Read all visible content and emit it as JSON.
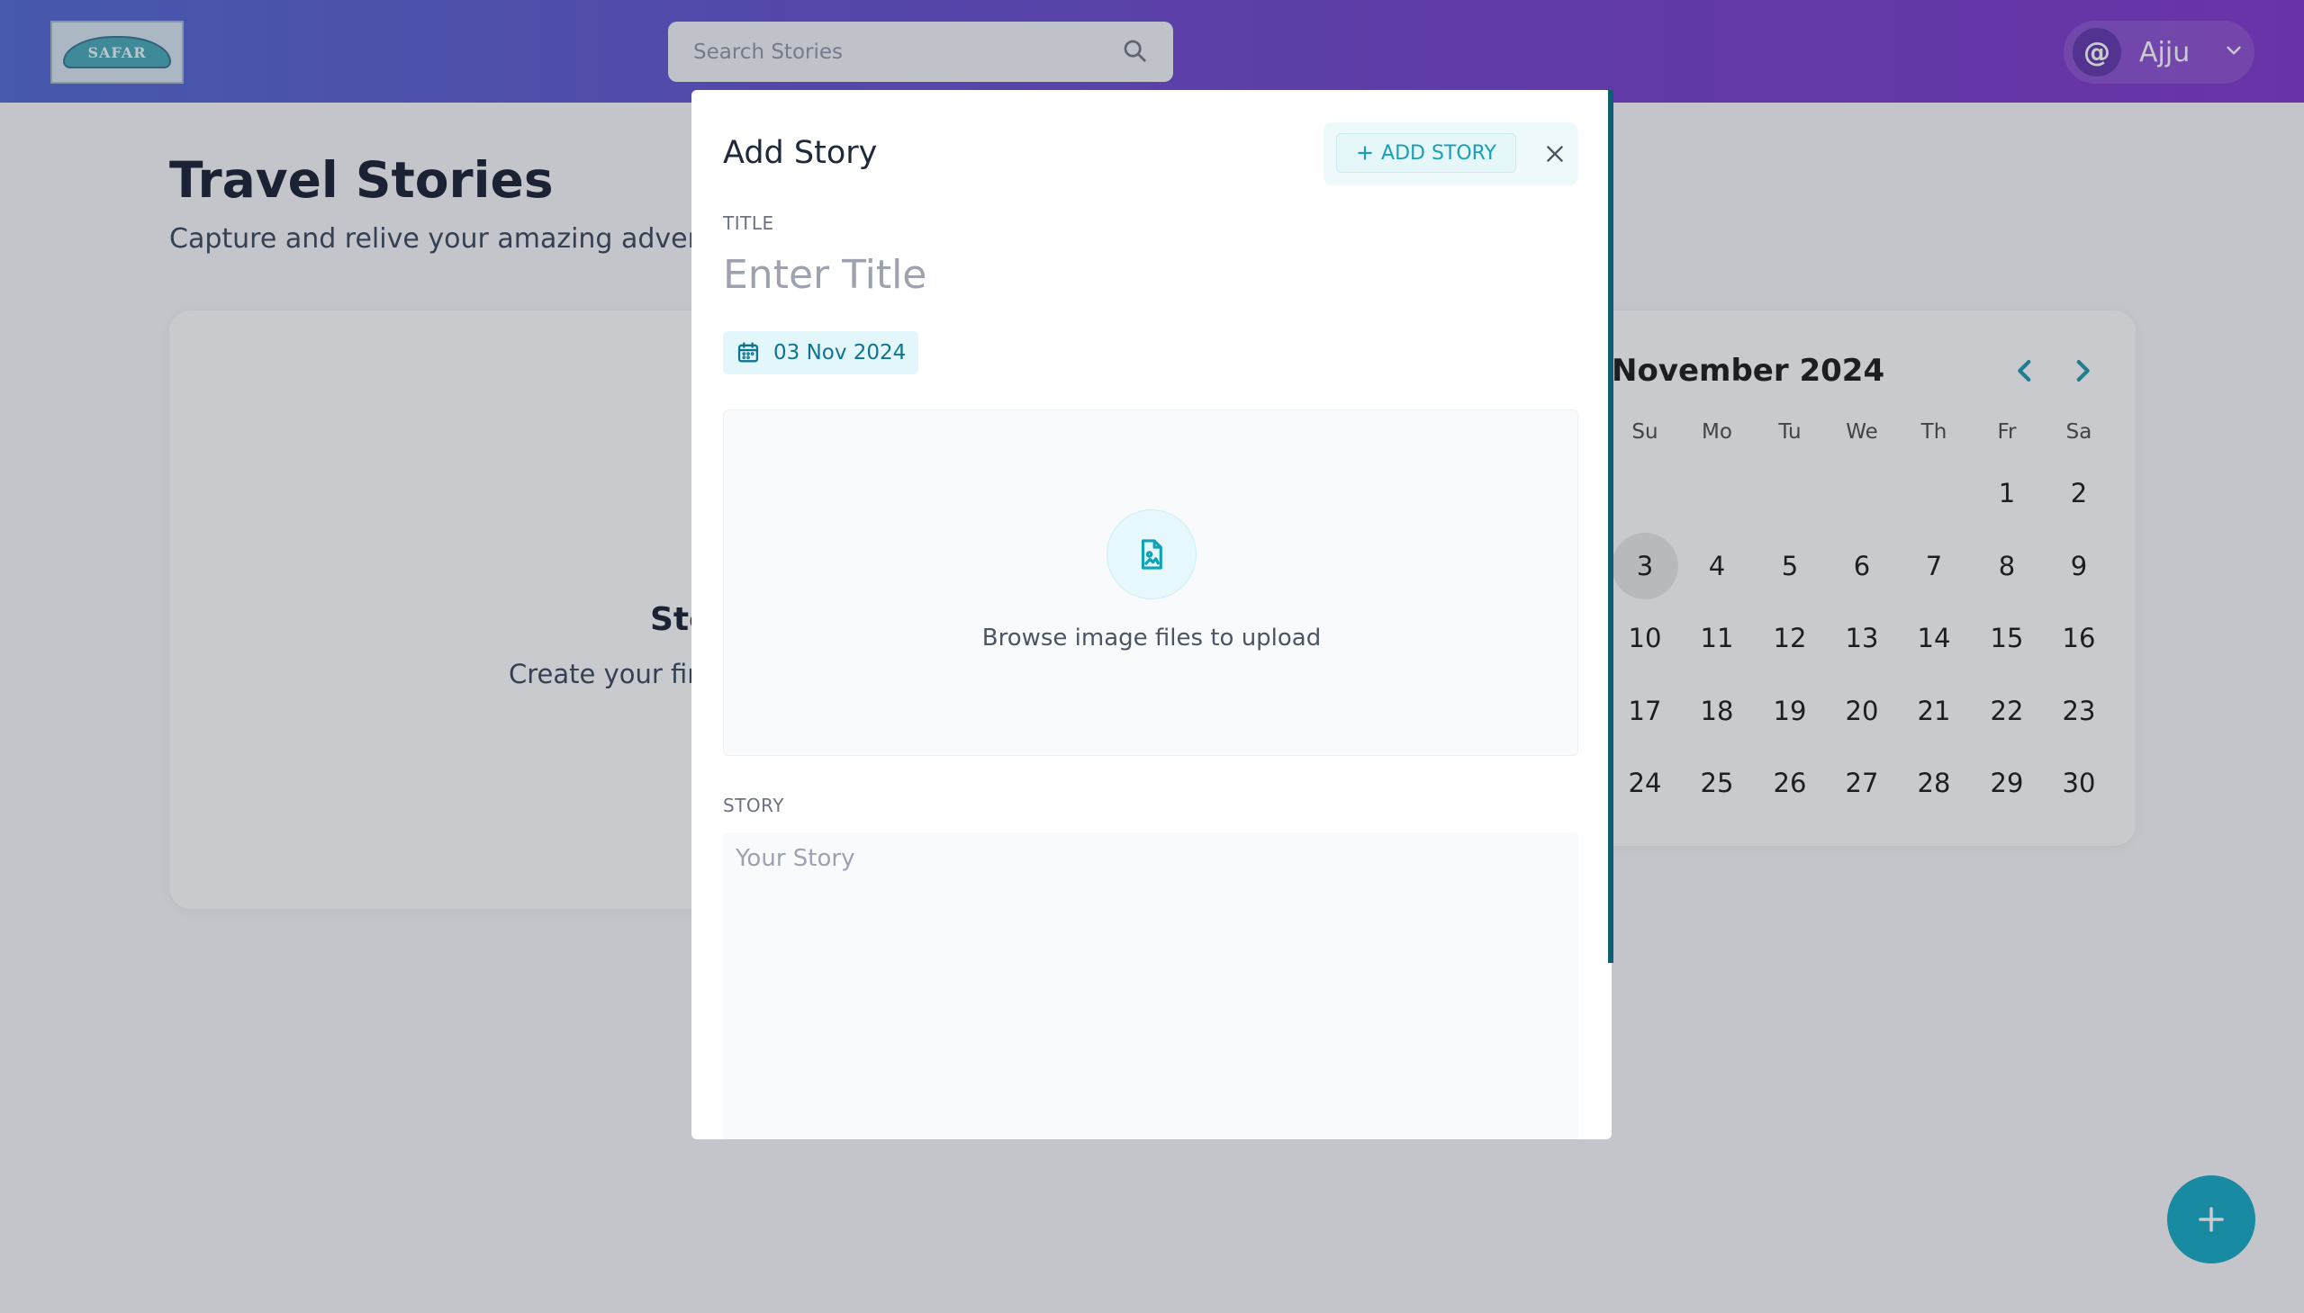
{
  "header": {
    "logo_text": "SAFAR",
    "search_placeholder": "Search Stories",
    "user_initial": "@",
    "user_name": "Ajju"
  },
  "page": {
    "title": "Travel Stories",
    "subtitle": "Capture and relive your amazing adventu",
    "empty_title": "Sto",
    "empty_subtitle": "Create your fir"
  },
  "calendar": {
    "month_label": "November 2024",
    "weekdays": [
      "Su",
      "Mo",
      "Tu",
      "We",
      "Th",
      "Fr",
      "Sa"
    ],
    "days": [
      "1",
      "2",
      "3",
      "4",
      "5",
      "6",
      "7",
      "8",
      "9",
      "10",
      "11",
      "12",
      "13",
      "14",
      "15",
      "16",
      "17",
      "18",
      "19",
      "20",
      "21",
      "22",
      "23",
      "24",
      "25",
      "26",
      "27",
      "28",
      "29",
      "30"
    ],
    "selected_day": "3",
    "accent": "#1796a9"
  },
  "modal": {
    "title": "Add Story",
    "add_story_label": "ADD STORY",
    "title_label": "TITLE",
    "title_placeholder": "Enter Title",
    "date_value": "03 Nov 2024",
    "upload_text": "Browse image files to upload",
    "story_label": "STORY",
    "story_placeholder": "Your Story"
  },
  "fab": {
    "icon": "plus-icon",
    "color": "#0aa7c2"
  }
}
